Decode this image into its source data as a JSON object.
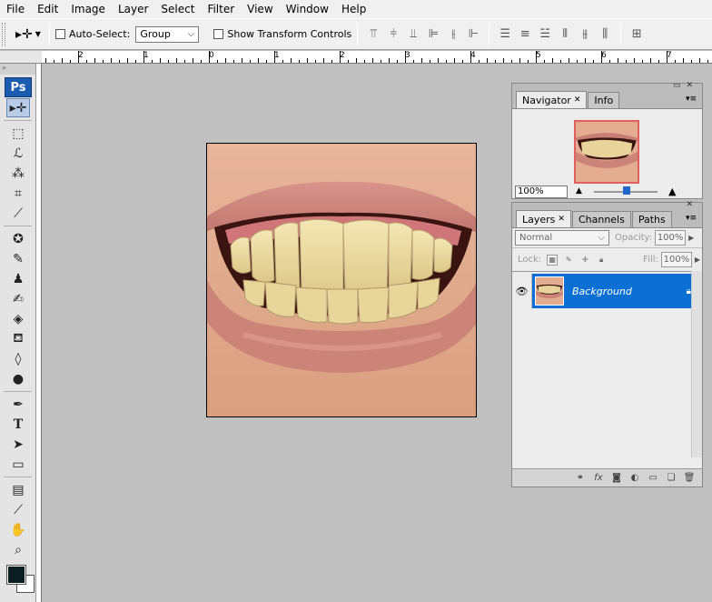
{
  "menu": [
    "File",
    "Edit",
    "Image",
    "Layer",
    "Select",
    "Filter",
    "View",
    "Window",
    "Help"
  ],
  "options": {
    "auto_select_label": "Auto-Select:",
    "auto_select_value": "Group",
    "show_transform_label": "Show Transform Controls"
  },
  "ruler": {
    "labels": [
      "2",
      "1",
      "0",
      "1",
      "2",
      "3",
      "4",
      "5",
      "6",
      "7"
    ]
  },
  "toolbox": {
    "logo": "Ps"
  },
  "navigator": {
    "tabs": [
      "Navigator",
      "Info"
    ],
    "zoom": "100%"
  },
  "layers": {
    "tabs": [
      "Layers",
      "Channels",
      "Paths"
    ],
    "blend_mode": "Normal",
    "opacity_label": "Opacity:",
    "opacity_value": "100%",
    "lock_label": "Lock:",
    "fill_label": "Fill:",
    "fill_value": "100%",
    "layer_name": "Background"
  },
  "colors": {
    "foreground": "#0a1e22",
    "background": "#ffffff",
    "selection": "#0b6fd4"
  }
}
